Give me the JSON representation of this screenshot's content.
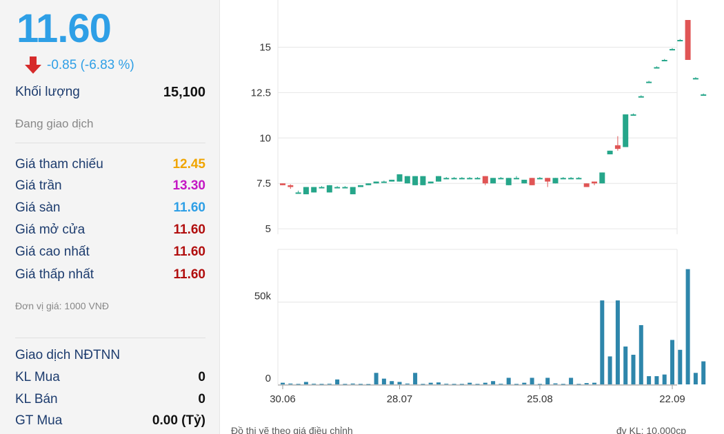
{
  "quote": {
    "price": "11.60",
    "change": "-0.85 (-6.83 %)",
    "volume_label": "Khối lượng",
    "volume": "15,100",
    "status": "Đang giao dịch"
  },
  "stats": [
    {
      "label": "Giá tham chiếu",
      "value": "12.45",
      "color": "#f0a500"
    },
    {
      "label": "Giá trần",
      "value": "13.30",
      "color": "#c418c4"
    },
    {
      "label": "Giá sàn",
      "value": "11.60",
      "color": "#2e9fe6"
    },
    {
      "label": "Giá mở cửa",
      "value": "11.60",
      "color": "#b10e0e"
    },
    {
      "label": "Giá cao nhất",
      "value": "11.60",
      "color": "#b10e0e"
    },
    {
      "label": "Giá thấp nhất",
      "value": "11.60",
      "color": "#b10e0e"
    }
  ],
  "unit_note": "Đơn vị giá: 1000 VNĐ",
  "foreign": {
    "title": "Giao dịch NĐTNN",
    "rows": [
      {
        "label": "KL Mua",
        "value": "0"
      },
      {
        "label": "KL Bán",
        "value": "0"
      },
      {
        "label": "GT Mua",
        "value": "0.00 (Tỷ)"
      }
    ]
  },
  "chart_data": {
    "type": "candlestick",
    "colors": {
      "up": "#26a68a",
      "down": "#e05555",
      "grid": "#e6e6e6",
      "volume": "#2e86ab"
    },
    "price_axis": {
      "ticks": [
        5,
        7.5,
        10,
        12.5,
        15
      ],
      "tick_labels": [
        "5",
        "7.5",
        "10",
        "12.5",
        "15"
      ],
      "ylim": [
        4.7,
        17.6
      ]
    },
    "volume_axis": {
      "ticks": [
        0,
        50000
      ],
      "tick_labels": [
        "0",
        "50k"
      ],
      "ylim": [
        0,
        82000
      ]
    },
    "x_labels": [
      {
        "index": 0,
        "label": "30.06"
      },
      {
        "index": 15,
        "label": "28.07"
      },
      {
        "index": 33,
        "label": "25.08"
      },
      {
        "index": 50,
        "label": "22.09"
      }
    ],
    "candles": [
      {
        "o": 7.5,
        "c": 7.4,
        "h": 7.5,
        "l": 7.4,
        "v": 1000
      },
      {
        "o": 7.4,
        "c": 7.3,
        "h": 7.45,
        "l": 7.2,
        "v": 500
      },
      {
        "o": 7.0,
        "c": 7.0,
        "h": 7.1,
        "l": 6.95,
        "v": 300
      },
      {
        "o": 6.9,
        "c": 7.3,
        "h": 7.3,
        "l": 6.9,
        "v": 1500
      },
      {
        "o": 7.0,
        "c": 7.3,
        "h": 7.3,
        "l": 7.0,
        "v": 400
      },
      {
        "o": 7.3,
        "c": 7.3,
        "h": 7.35,
        "l": 7.25,
        "v": 300
      },
      {
        "o": 7.0,
        "c": 7.4,
        "h": 7.4,
        "l": 7.0,
        "v": 400
      },
      {
        "o": 7.3,
        "c": 7.3,
        "h": 7.35,
        "l": 7.25,
        "v": 3000
      },
      {
        "o": 7.3,
        "c": 7.3,
        "h": 7.35,
        "l": 7.25,
        "v": 300
      },
      {
        "o": 6.9,
        "c": 7.3,
        "h": 7.3,
        "l": 6.9,
        "v": 500
      },
      {
        "o": 7.3,
        "c": 7.4,
        "h": 7.4,
        "l": 7.3,
        "v": 300
      },
      {
        "o": 7.4,
        "c": 7.5,
        "h": 7.5,
        "l": 7.4,
        "v": 200
      },
      {
        "o": 7.5,
        "c": 7.6,
        "h": 7.6,
        "l": 7.5,
        "v": 7000
      },
      {
        "o": 7.6,
        "c": 7.6,
        "h": 7.65,
        "l": 7.55,
        "v": 3500
      },
      {
        "o": 7.6,
        "c": 7.7,
        "h": 7.7,
        "l": 7.6,
        "v": 2000
      },
      {
        "o": 7.6,
        "c": 8.0,
        "h": 8.0,
        "l": 7.6,
        "v": 1500
      },
      {
        "o": 7.5,
        "c": 7.9,
        "h": 7.9,
        "l": 7.5,
        "v": 500
      },
      {
        "o": 7.4,
        "c": 7.9,
        "h": 7.9,
        "l": 7.4,
        "v": 7000
      },
      {
        "o": 7.4,
        "c": 7.9,
        "h": 7.9,
        "l": 7.4,
        "v": 300
      },
      {
        "o": 7.5,
        "c": 7.6,
        "h": 7.6,
        "l": 7.5,
        "v": 1000
      },
      {
        "o": 7.6,
        "c": 7.9,
        "h": 7.9,
        "l": 7.6,
        "v": 1200
      },
      {
        "o": 7.8,
        "c": 7.8,
        "h": 7.85,
        "l": 7.75,
        "v": 400
      },
      {
        "o": 7.8,
        "c": 7.8,
        "h": 7.85,
        "l": 7.75,
        "v": 300
      },
      {
        "o": 7.8,
        "c": 7.8,
        "h": 7.85,
        "l": 7.75,
        "v": 300
      },
      {
        "o": 7.8,
        "c": 7.8,
        "h": 7.85,
        "l": 7.75,
        "v": 1000
      },
      {
        "o": 7.8,
        "c": 7.8,
        "h": 7.85,
        "l": 7.75,
        "v": 300
      },
      {
        "o": 7.9,
        "c": 7.5,
        "h": 7.9,
        "l": 7.4,
        "v": 1000
      },
      {
        "o": 7.5,
        "c": 7.8,
        "h": 7.8,
        "l": 7.5,
        "v": 2000
      },
      {
        "o": 7.8,
        "c": 7.8,
        "h": 7.85,
        "l": 7.75,
        "v": 400
      },
      {
        "o": 7.4,
        "c": 7.8,
        "h": 7.8,
        "l": 7.4,
        "v": 4000
      },
      {
        "o": 7.8,
        "c": 7.8,
        "h": 7.9,
        "l": 7.75,
        "v": 300
      },
      {
        "o": 7.5,
        "c": 7.7,
        "h": 7.7,
        "l": 7.5,
        "v": 1000
      },
      {
        "o": 7.8,
        "c": 7.4,
        "h": 7.8,
        "l": 7.4,
        "v": 4000
      },
      {
        "o": 7.8,
        "c": 7.8,
        "h": 7.85,
        "l": 7.75,
        "v": 300
      },
      {
        "o": 7.8,
        "c": 7.6,
        "h": 7.8,
        "l": 7.3,
        "v": 4000
      },
      {
        "o": 7.5,
        "c": 7.8,
        "h": 7.8,
        "l": 7.5,
        "v": 600
      },
      {
        "o": 7.8,
        "c": 7.8,
        "h": 7.85,
        "l": 7.75,
        "v": 300
      },
      {
        "o": 7.8,
        "c": 7.8,
        "h": 7.85,
        "l": 7.75,
        "v": 4000
      },
      {
        "o": 7.8,
        "c": 7.8,
        "h": 7.85,
        "l": 7.75,
        "v": 300
      },
      {
        "o": 7.5,
        "c": 7.3,
        "h": 7.5,
        "l": 7.3,
        "v": 800
      },
      {
        "o": 7.6,
        "c": 7.5,
        "h": 7.6,
        "l": 7.4,
        "v": 1000
      },
      {
        "o": 7.5,
        "c": 8.1,
        "h": 8.1,
        "l": 7.5,
        "v": 51000
      },
      {
        "o": 9.1,
        "c": 9.3,
        "h": 9.3,
        "l": 9.1,
        "v": 17000
      },
      {
        "o": 9.6,
        "c": 9.4,
        "h": 10.1,
        "l": 9.3,
        "v": 51000
      },
      {
        "o": 9.5,
        "c": 11.3,
        "h": 11.3,
        "l": 9.5,
        "v": 23000
      },
      {
        "o": 11.3,
        "c": 11.3,
        "h": 11.35,
        "l": 11.25,
        "v": 18000
      },
      {
        "o": 12.3,
        "c": 12.3,
        "h": 12.35,
        "l": 12.25,
        "v": 36000
      },
      {
        "o": 13.1,
        "c": 13.1,
        "h": 13.15,
        "l": 13.05,
        "v": 5000
      },
      {
        "o": 13.9,
        "c": 13.9,
        "h": 13.95,
        "l": 13.85,
        "v": 5000
      },
      {
        "o": 14.3,
        "c": 14.3,
        "h": 14.35,
        "l": 14.25,
        "v": 6000
      },
      {
        "o": 14.9,
        "c": 14.9,
        "h": 14.95,
        "l": 14.85,
        "v": 27000
      },
      {
        "o": 15.4,
        "c": 15.4,
        "h": 15.45,
        "l": 15.35,
        "v": 21000
      },
      {
        "o": 16.5,
        "c": 14.3,
        "h": 16.5,
        "l": 14.3,
        "v": 70000
      },
      {
        "o": 13.3,
        "c": 13.3,
        "h": 13.35,
        "l": 13.25,
        "v": 7000
      },
      {
        "o": 12.4,
        "c": 12.4,
        "h": 12.45,
        "l": 12.35,
        "v": 14000
      }
    ],
    "footer_left": "Đồ thị vẽ theo giá điều chỉnh",
    "footer_right": "đv KL: 10,000cp"
  }
}
